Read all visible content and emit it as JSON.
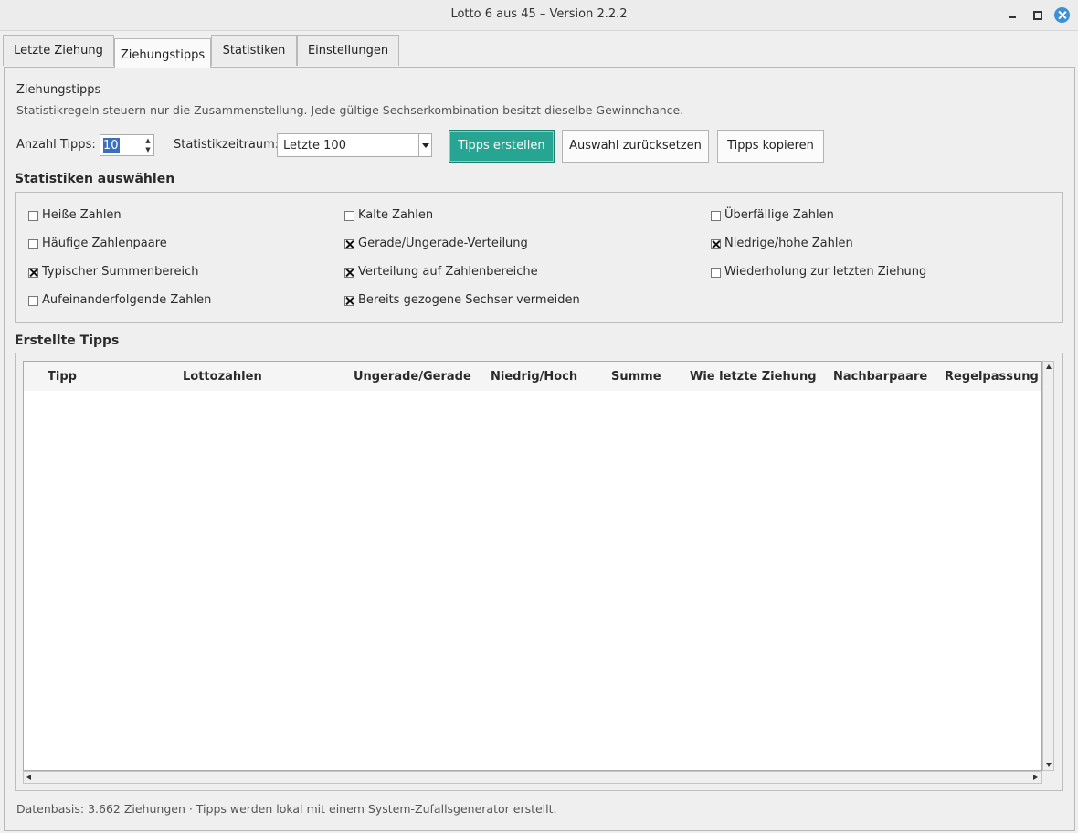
{
  "window": {
    "title": "Lotto 6 aus 45 – Version 2.2.2"
  },
  "tabs": [
    {
      "label": "Letzte Ziehung"
    },
    {
      "label": "Ziehungstipps"
    },
    {
      "label": "Statistiken"
    },
    {
      "label": "Einstellungen"
    }
  ],
  "tips": {
    "heading": "Ziehungstipps",
    "description": "Statistikregeln steuern nur die Zusammenstellung. Jede gültige Sechserkombination besitzt dieselbe Gewinnchance.",
    "count_label": "Anzahl Tipps:",
    "count_value": "10",
    "period_label": "Statistikzeitraum:",
    "period_value": "Letzte 100",
    "create_button": "Tipps erstellen",
    "reset_button": "Auswahl zurücksetzen",
    "copy_button": "Tipps kopieren"
  },
  "stats": {
    "heading": "Statistiken auswählen",
    "options": [
      {
        "label": "Heiße Zahlen",
        "checked": false
      },
      {
        "label": "Kalte Zahlen",
        "checked": false
      },
      {
        "label": "Überfällige Zahlen",
        "checked": false
      },
      {
        "label": "Häufige Zahlenpaare",
        "checked": false
      },
      {
        "label": "Gerade/Ungerade-Verteilung",
        "checked": true
      },
      {
        "label": "Niedrige/hohe Zahlen",
        "checked": true
      },
      {
        "label": "Typischer Summenbereich",
        "checked": true
      },
      {
        "label": "Verteilung auf Zahlenbereiche",
        "checked": true
      },
      {
        "label": "Wiederholung zur letzten Ziehung",
        "checked": false
      },
      {
        "label": "Aufeinanderfolgende Zahlen",
        "checked": false
      },
      {
        "label": "Bereits gezogene Sechser vermeiden",
        "checked": true
      }
    ]
  },
  "results": {
    "heading": "Erstellte Tipps",
    "columns": [
      "Tipp",
      "Lottozahlen",
      "Ungerade/Gerade",
      "Niedrig/Hoch",
      "Summe",
      "Wie letzte Ziehung",
      "Nachbarpaare",
      "Regelpassung"
    ]
  },
  "footer": {
    "text": "Datenbasis: 3.662 Ziehungen · Tipps werden lokal mit einem System-Zufallsgenerator erstellt."
  }
}
